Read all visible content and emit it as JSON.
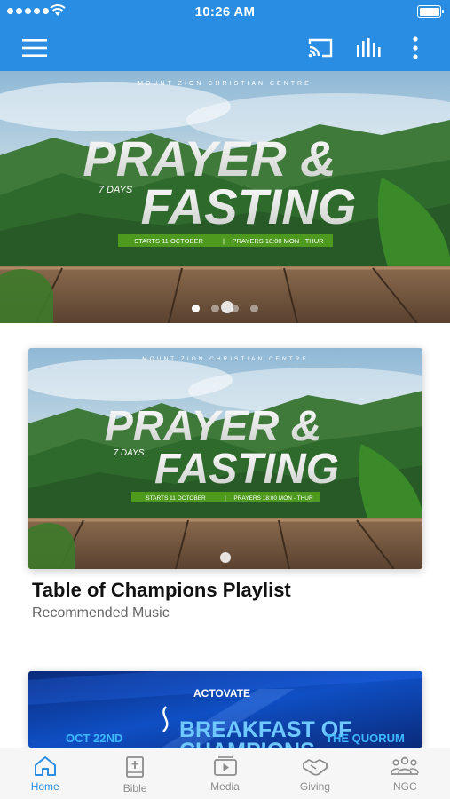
{
  "status_bar": {
    "time": "10:26 AM"
  },
  "app_bar": {
    "icons": [
      "menu-icon",
      "cast-icon",
      "equalizer-icon",
      "more-vertical-icon"
    ]
  },
  "hero": {
    "org": "MOUNT ZION CHRISTIAN CENTRE",
    "title_line1": "PRAYER &",
    "days": "7 DAYS",
    "title_line2": "FASTING",
    "banner_left": "STARTS 11 OCTOBER",
    "banner_right": "PRAYERS 18:00 MON - THUR",
    "slides_count": 4,
    "active_slide": 1
  },
  "featured": {
    "org": "MOUNT ZION CHRISTIAN CENTRE",
    "title_line1": "PRAYER &",
    "days": "7 DAYS",
    "title_line2": "FASTING",
    "banner_left": "STARTS 11 OCTOBER",
    "banner_right": "PRAYERS 18:00 MON - THUR",
    "title": "Table of Champions Playlist",
    "subtitle": "Recommended Music"
  },
  "second_card": {
    "brand": "ACTOVATE",
    "date": "OCT 22ND",
    "event_line1": "BREAKFAST OF",
    "event_line2": "CHAMPIONS",
    "venue": "THE QUORUM"
  },
  "tabs": [
    {
      "label": "Home",
      "icon": "home-icon",
      "active": true
    },
    {
      "label": "Bible",
      "icon": "bible-icon",
      "active": false
    },
    {
      "label": "Media",
      "icon": "media-icon",
      "active": false
    },
    {
      "label": "Giving",
      "icon": "giving-icon",
      "active": false
    },
    {
      "label": "NGC",
      "icon": "ngc-icon",
      "active": false
    }
  ],
  "colors": {
    "primary": "#2a8de4",
    "tab_inactive": "#8c8c8c",
    "banner_green": "#4e9a1e"
  }
}
